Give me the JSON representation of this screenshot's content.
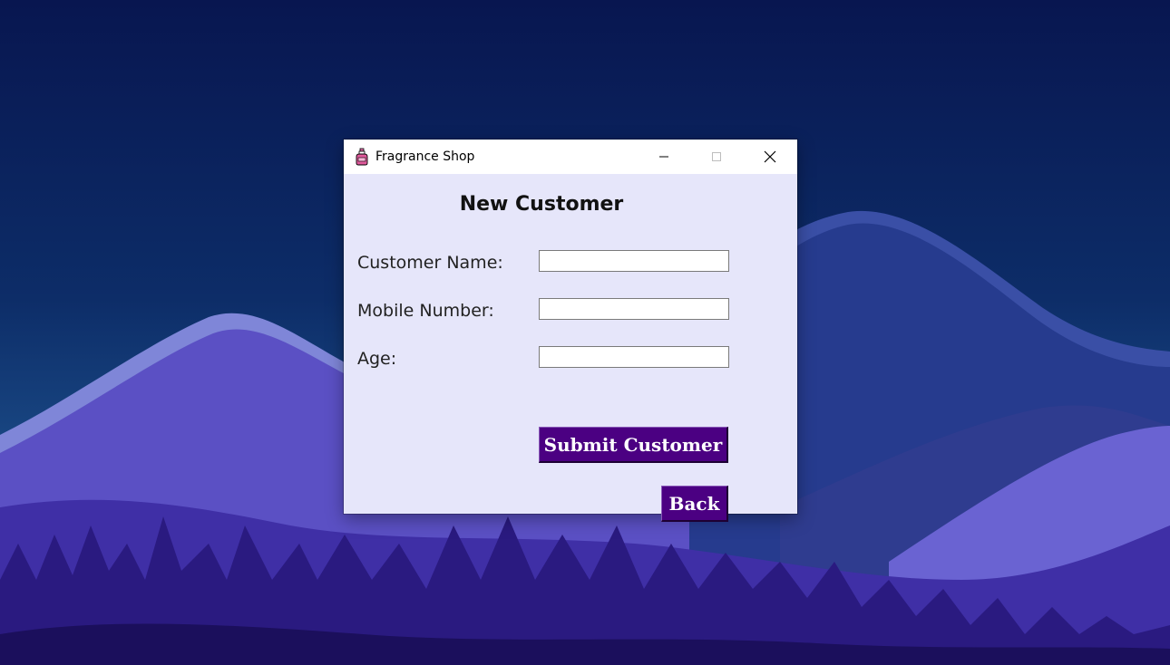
{
  "window": {
    "title": "Fragrance Shop",
    "icon": "perfume-bottle-icon"
  },
  "form": {
    "heading": "New Customer",
    "fields": [
      {
        "label": "Customer Name:",
        "value": ""
      },
      {
        "label": "Mobile Number:",
        "value": ""
      },
      {
        "label": "Age:",
        "value": ""
      }
    ],
    "submit_label": "Submit Customer",
    "back_label": "Back"
  },
  "colors": {
    "window_background": "#e6e6fa",
    "button_background": "#4b0082",
    "button_text": "#ffffff"
  }
}
